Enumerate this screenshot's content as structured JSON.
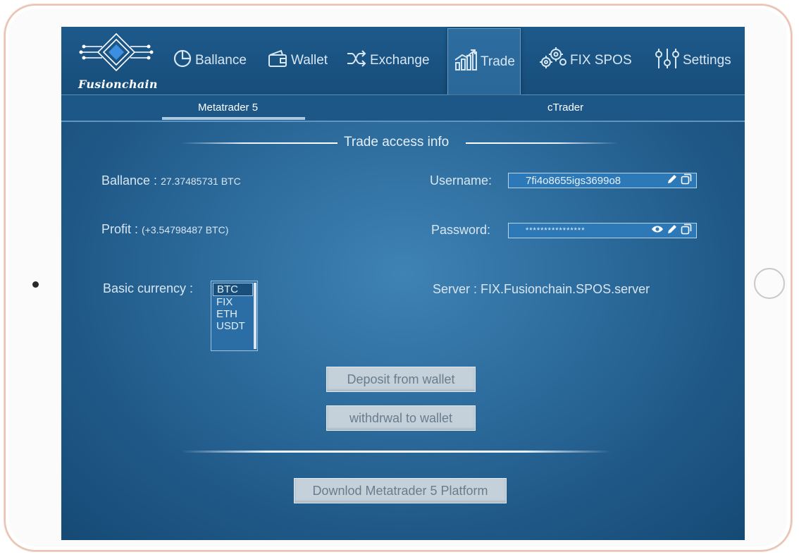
{
  "app": {
    "brand": "Fusionchain"
  },
  "nav": {
    "items": [
      {
        "label": "Ballance",
        "icon": "pie-chart-icon"
      },
      {
        "label": "Wallet",
        "icon": "wallet-icon"
      },
      {
        "label": "Exchange",
        "icon": "shuffle-icon"
      },
      {
        "label": "Trade",
        "icon": "bar-chart-icon"
      },
      {
        "label": "FIX SPOS",
        "icon": "gears-icon"
      },
      {
        "label": "Settings",
        "icon": "sliders-icon"
      }
    ],
    "active": "Trade"
  },
  "subtabs": {
    "items": [
      "Metatrader 5",
      "cTrader"
    ],
    "active": "Metatrader 5"
  },
  "main": {
    "section_title": "Trade access info",
    "balance_label": "Ballance :",
    "balance_value": "27.37485731 BTC",
    "profit_label": "Profit :",
    "profit_value": "(+3.54798487 BTC)",
    "currency_label": "Basic currency :",
    "currency_options": [
      "BTC",
      "FIX",
      "ETH",
      "USDT"
    ],
    "currency_selected": "BTC",
    "username_label": "Username:",
    "username_value": "7fi4o8655igs3699o8",
    "password_label": "Password:",
    "password_value": "****************",
    "server_text": "Server : FIX.Fusionchain.SPOS.server",
    "deposit_button": "Deposit from wallet",
    "withdraw_button": "withdrwal to wallet",
    "download_button": "Downlod Metatrader 5 Platform"
  },
  "colors": {
    "screen_bg": "#2e6e9f",
    "nav_bg": "#1d5a8c",
    "field_bg": "#2d78b7",
    "button_bg": "#c4d1db",
    "device_frame": "#e9c2b2"
  }
}
